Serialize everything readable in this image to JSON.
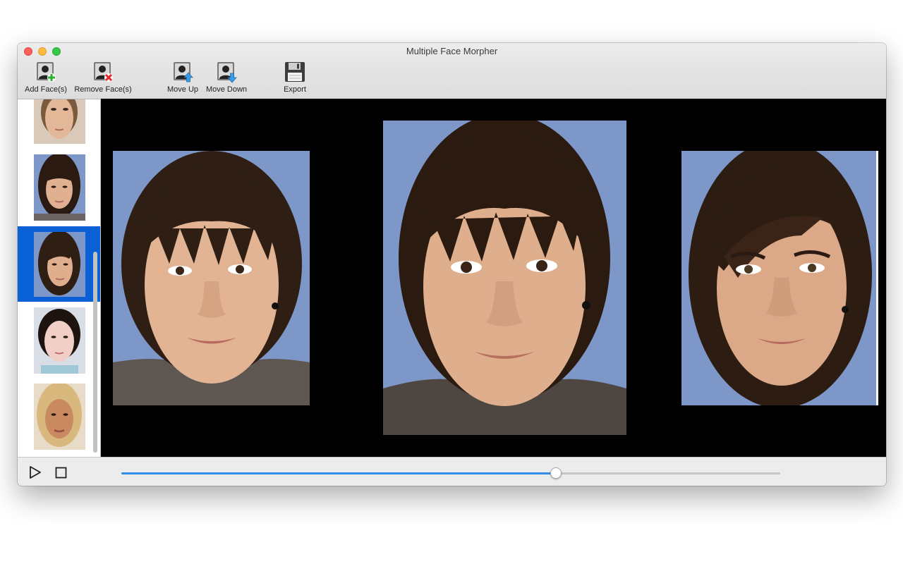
{
  "window": {
    "title": "Multiple Face Morpher"
  },
  "toolbar": {
    "add_label": "Add Face(s)",
    "remove_label": "Remove Face(s)",
    "move_up_label": "Move Up",
    "move_down_label": "Move Down",
    "export_label": "Export"
  },
  "sidebar": {
    "selected_index": 2,
    "faces": [
      {
        "icon": "face-thumbnail-1"
      },
      {
        "icon": "face-thumbnail-2"
      },
      {
        "icon": "face-thumbnail-3"
      },
      {
        "icon": "face-thumbnail-4"
      },
      {
        "icon": "face-thumbnail-5"
      }
    ]
  },
  "stage": {
    "panels": [
      "source-face",
      "morph-result",
      "target-face"
    ]
  },
  "playback": {
    "progress": 0.66
  },
  "colors": {
    "accent": "#2f8ee6",
    "selection": "#0a61d6",
    "photo_background": "#7d97c9"
  }
}
